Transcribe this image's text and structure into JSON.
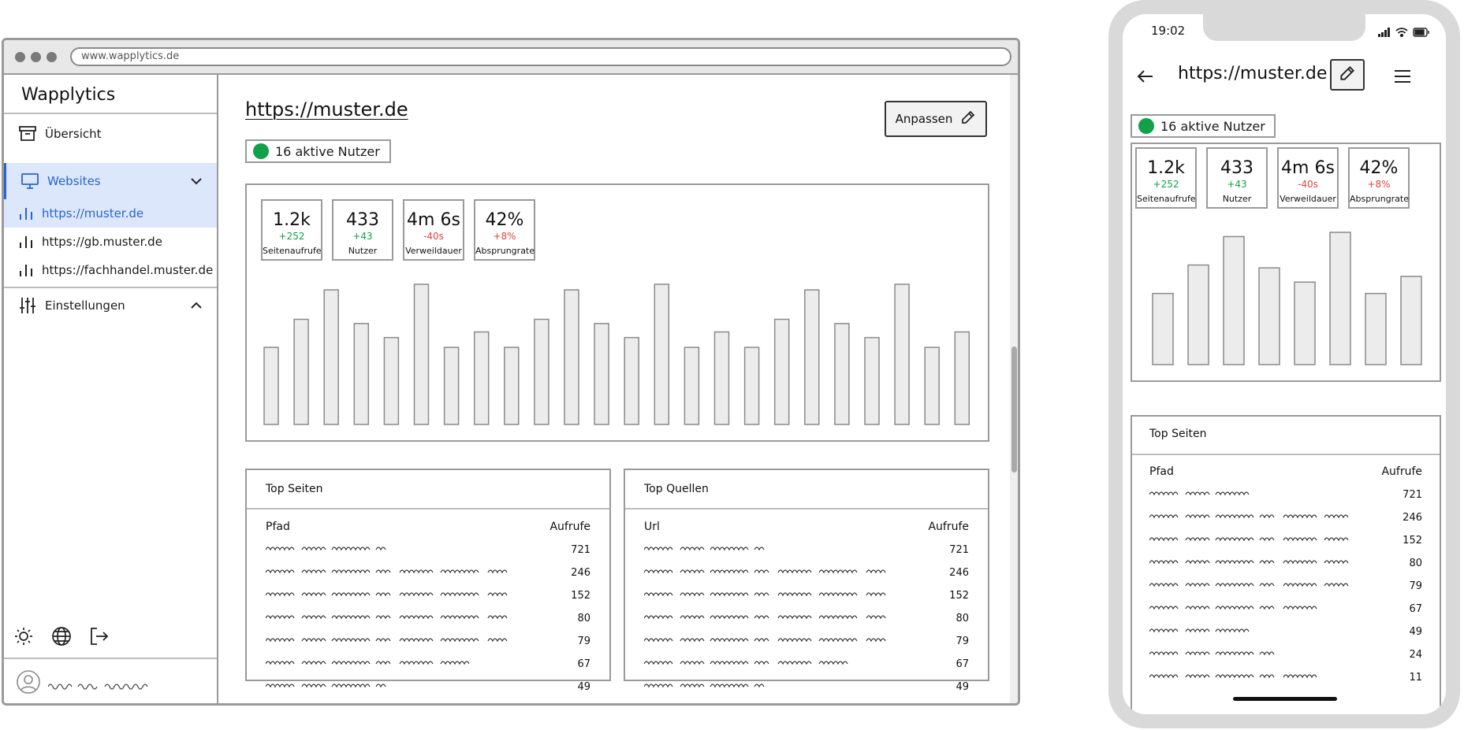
{
  "browser": {
    "url": "www.wapplytics.de"
  },
  "sidebar": {
    "brand": "Wapplytics",
    "overview_label": "Übersicht",
    "websites_label": "Websites",
    "sites": [
      "https://muster.de",
      "https://gb.muster.de",
      "https://fachhandel.muster.de"
    ],
    "settings_label": "Einstellungen"
  },
  "main": {
    "title": "https://muster.de",
    "customize_label": "Anpassen",
    "active_users": "16 aktive Nutzer",
    "kpis": [
      {
        "value": "1.2k",
        "delta": "+252",
        "label": "Seitenaufrufe",
        "trend": "pos"
      },
      {
        "value": "433",
        "delta": "+43",
        "label": "Nutzer",
        "trend": "pos"
      },
      {
        "value": "4m 6s",
        "delta": "-40s",
        "label": "Verweildauer",
        "trend": "neg"
      },
      {
        "value": "42%",
        "delta": "+8%",
        "label": "Absprungrate",
        "trend": "neg"
      }
    ],
    "top_pages": {
      "title": "Top Seiten",
      "col_path": "Pfad",
      "col_views": "Aufrufe",
      "values": [
        "721",
        "246",
        "152",
        "80",
        "79",
        "67",
        "49"
      ]
    },
    "top_sources": {
      "title": "Top Quellen",
      "col_url": "Url",
      "col_views": "Aufrufe",
      "values": [
        "721",
        "246",
        "152",
        "80",
        "79",
        "67",
        "49"
      ]
    }
  },
  "mobile": {
    "time": "19:02",
    "title": "https://muster.de",
    "active_users": "16 aktive Nutzer",
    "kpis": [
      {
        "value": "1.2k",
        "delta": "+252",
        "label": "Seitenaufrufe",
        "trend": "pos"
      },
      {
        "value": "433",
        "delta": "+43",
        "label": "Nutzer",
        "trend": "pos"
      },
      {
        "value": "4m 6s",
        "delta": "-40s",
        "label": "Verweildauer",
        "trend": "neg"
      },
      {
        "value": "42%",
        "delta": "+8%",
        "label": "Absprungrate",
        "trend": "neg"
      }
    ],
    "top_pages": {
      "title": "Top Seiten",
      "col_path": "Pfad",
      "col_views": "Aufrufe",
      "values": [
        "721",
        "246",
        "152",
        "80",
        "79",
        "67",
        "49",
        "24",
        "11"
      ]
    }
  },
  "chart_data": [
    {
      "type": "bar",
      "values": [
        55,
        75,
        96,
        72,
        62,
        100,
        55,
        66,
        55,
        75,
        96,
        72,
        62,
        100,
        55,
        66,
        55,
        75,
        96,
        72,
        62,
        100,
        55,
        66
      ]
    },
    {
      "type": "bar",
      "values": [
        50,
        70,
        90,
        68,
        58,
        93,
        50,
        62
      ]
    }
  ],
  "colors": {
    "accent": "#2a63d4",
    "accent_bg": "#dce7fb",
    "positive": "#13a04a",
    "negative": "#e04444"
  },
  "icons": [
    "archive-icon",
    "monitor-icon",
    "chevron-down-icon",
    "bar-chart-icon",
    "sliders-icon",
    "chevron-up-icon",
    "sun-icon",
    "globe-icon",
    "logout-icon",
    "user-icon",
    "pencil-icon",
    "arrow-left-icon",
    "menu-icon",
    "signal-icon",
    "wifi-icon",
    "battery-icon"
  ]
}
